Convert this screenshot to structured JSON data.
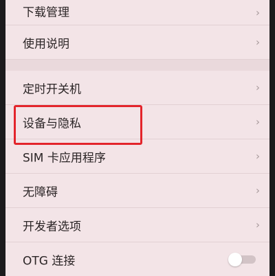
{
  "settings": {
    "items": [
      {
        "label": "下载管理",
        "chevron": "›"
      },
      {
        "label": "使用说明",
        "chevron": "›"
      },
      {
        "label": "定时开关机",
        "chevron": "›"
      },
      {
        "label": "设备与隐私",
        "chevron": "›",
        "highlighted": true
      },
      {
        "label": "SIM 卡应用程序",
        "chevron": "›"
      },
      {
        "label": "无障碍",
        "chevron": "›"
      },
      {
        "label": "开发者选项",
        "chevron": "›"
      },
      {
        "label": "OTG 连接",
        "toggle_on": false
      }
    ]
  },
  "annotation": {
    "color": "#e3242b"
  },
  "icons": {
    "chevron": "chevron-right-icon",
    "toggle": "toggle-switch"
  }
}
